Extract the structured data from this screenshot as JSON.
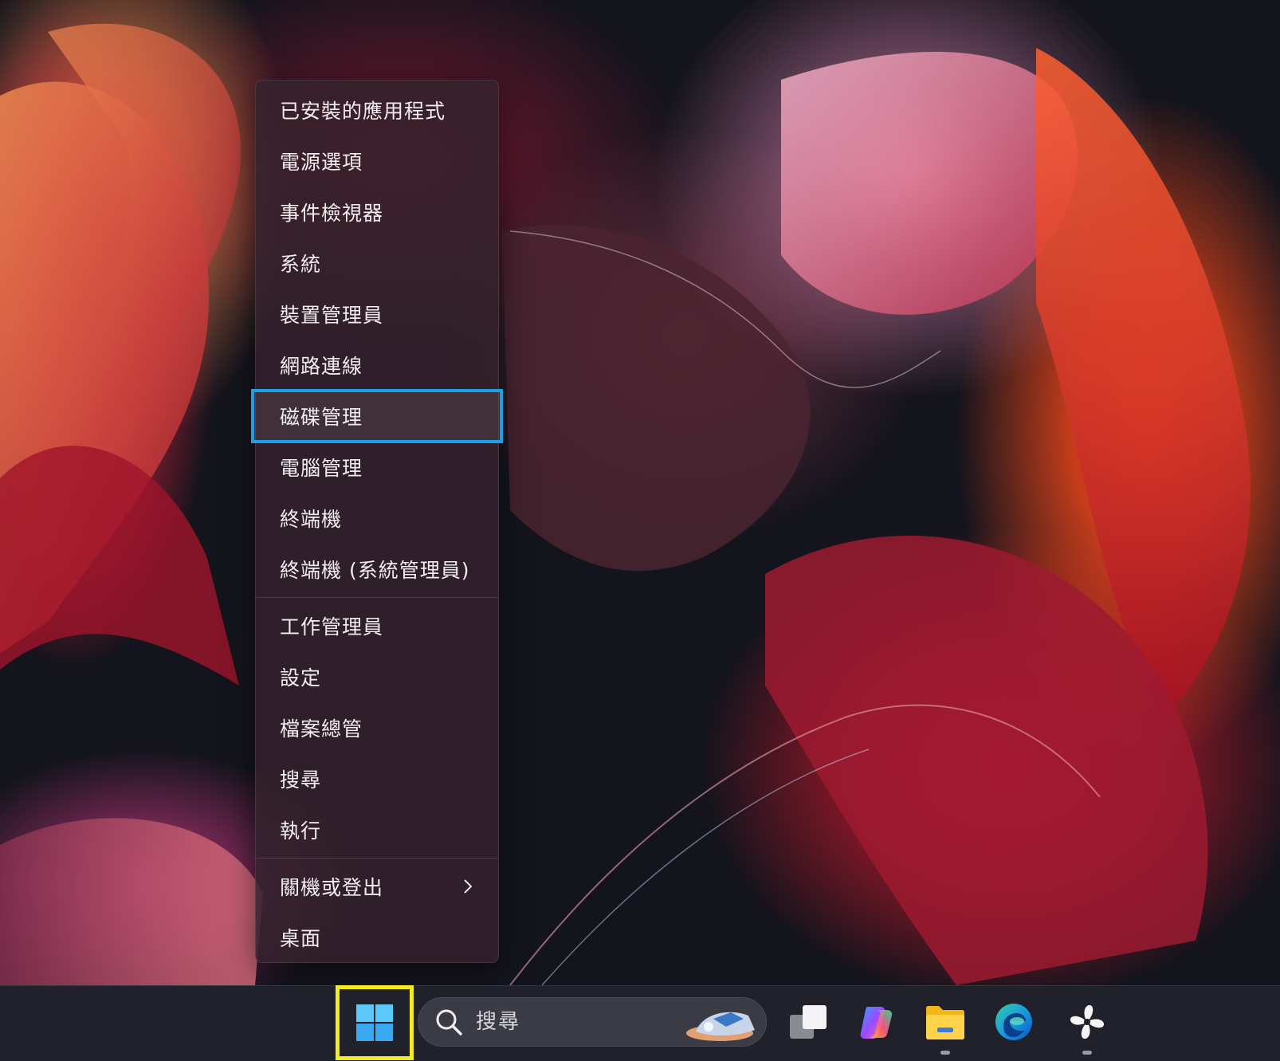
{
  "context_menu": {
    "items": [
      "已安裝的應用程式",
      "電源選項",
      "事件檢視器",
      "系統",
      "裝置管理員",
      "網路連線",
      "磁碟管理",
      "電腦管理",
      "終端機",
      "終端機 (系統管理員)",
      "工作管理員",
      "設定",
      "檔案總管",
      "搜尋",
      "執行",
      "關機或登出",
      "桌面"
    ],
    "highlight_color": "#1ea0e6"
  },
  "taskbar": {
    "search_placeholder": "搜尋",
    "start_highlight_color": "#f4ec1e",
    "icons": [
      "windows-start-icon",
      "task-view-icon",
      "copilot-icon",
      "file-explorer-icon",
      "edge-icon",
      "fan-app-icon"
    ]
  }
}
